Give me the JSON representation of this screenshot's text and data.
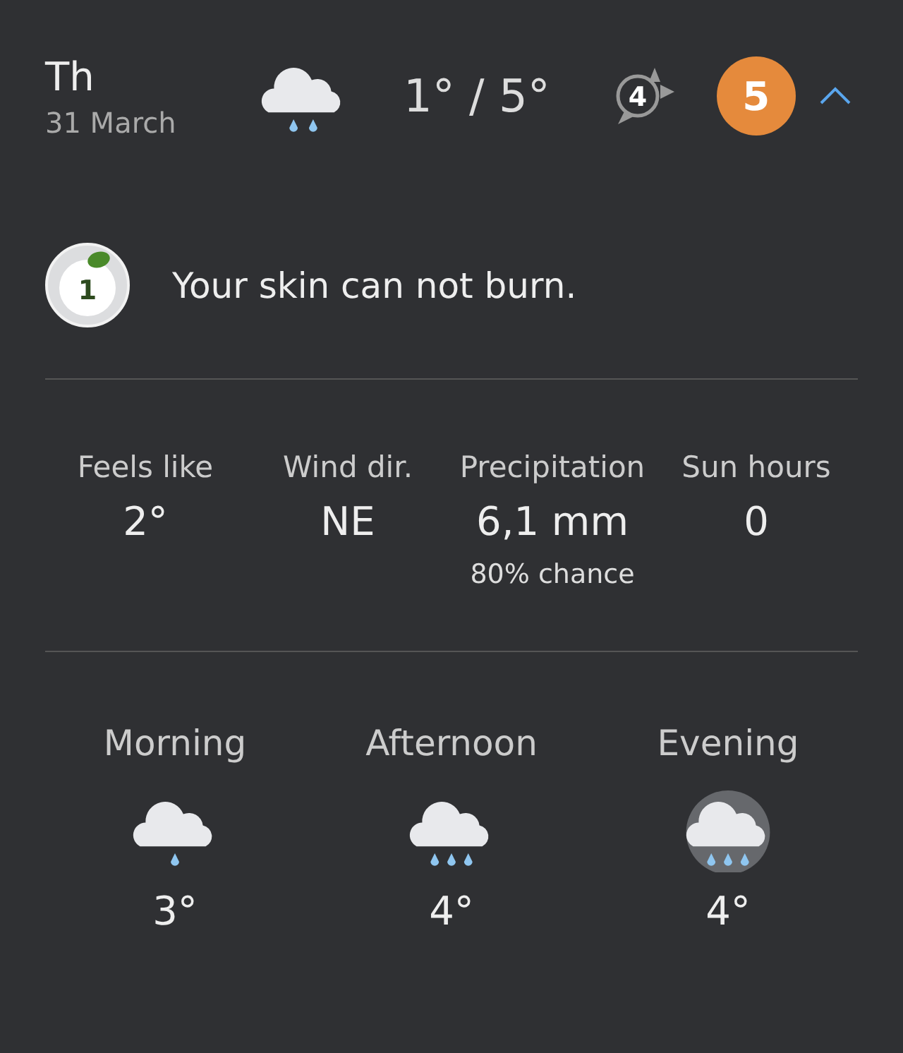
{
  "day": {
    "weekday": "Th",
    "date": "31 March",
    "weather": {
      "kind": "drizzle"
    },
    "temperature": "1° / 5°",
    "wind": {
      "speed": "4"
    },
    "uv": {
      "value": "5",
      "color": "#e58a3c"
    },
    "expanded": true
  },
  "uv_advice": {
    "index": "1",
    "text": "Your skin can not burn."
  },
  "stats": [
    {
      "label": "Feels like",
      "value": "2°"
    },
    {
      "label": "Wind dir.",
      "value": "NE"
    },
    {
      "label": "Precipitation",
      "value": "6,1 mm",
      "note": "80% chance"
    },
    {
      "label": "Sun hours",
      "value": "0"
    }
  ],
  "periods": [
    {
      "name": "Morning",
      "kind": "light_rain",
      "temperature": "3°"
    },
    {
      "name": "Afternoon",
      "kind": "rain",
      "temperature": "4°"
    },
    {
      "name": "Evening",
      "kind": "rain_night",
      "temperature": "4°"
    }
  ]
}
